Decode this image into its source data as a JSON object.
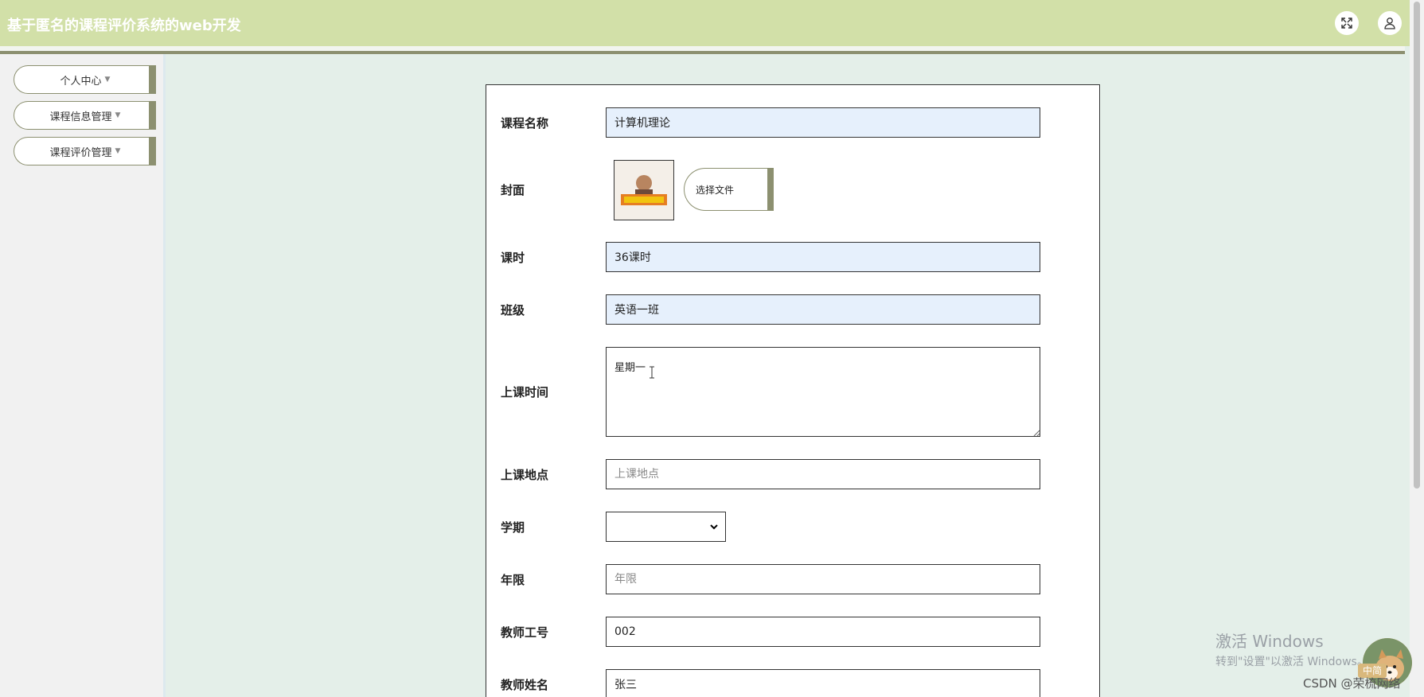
{
  "header": {
    "title": "基于匿名的课程评价系统的web开发",
    "fullscreen_icon": "expand-icon",
    "user_icon": "user-icon"
  },
  "sidebar": {
    "items": [
      {
        "label": "个人中心"
      },
      {
        "label": "课程信息管理"
      },
      {
        "label": "课程评价管理"
      }
    ],
    "caret_icon": "caret-down-icon"
  },
  "form": {
    "course_name": {
      "label": "课程名称",
      "value": "计算机理论"
    },
    "cover": {
      "label": "封面",
      "image_icon": "course-cover-image",
      "choose_file": "选择文件"
    },
    "hours": {
      "label": "课时",
      "value": "36课时"
    },
    "class": {
      "label": "班级",
      "value": "英语一班"
    },
    "time": {
      "label": "上课时间",
      "value": "星期一"
    },
    "location": {
      "label": "上课地点",
      "value": "",
      "placeholder": "上课地点"
    },
    "term": {
      "label": "学期",
      "value": ""
    },
    "years": {
      "label": "年限",
      "value": "",
      "placeholder": "年限"
    },
    "teacher_id": {
      "label": "教师工号",
      "value": "002"
    },
    "teacher_name": {
      "label": "教师姓名",
      "value": "张三"
    }
  },
  "overlay": {
    "activate_title": "激活 Windows",
    "activate_sub": "转到\"设置\"以激活 Windows。",
    "csdn": "CSDN @荣梳网络",
    "badge": "中简"
  },
  "colors": {
    "header_bg": "#d2e0a8",
    "accent_olive": "#8c9070",
    "content_bg": "#e4efe9",
    "filled_input_bg": "#e6f0fc"
  }
}
